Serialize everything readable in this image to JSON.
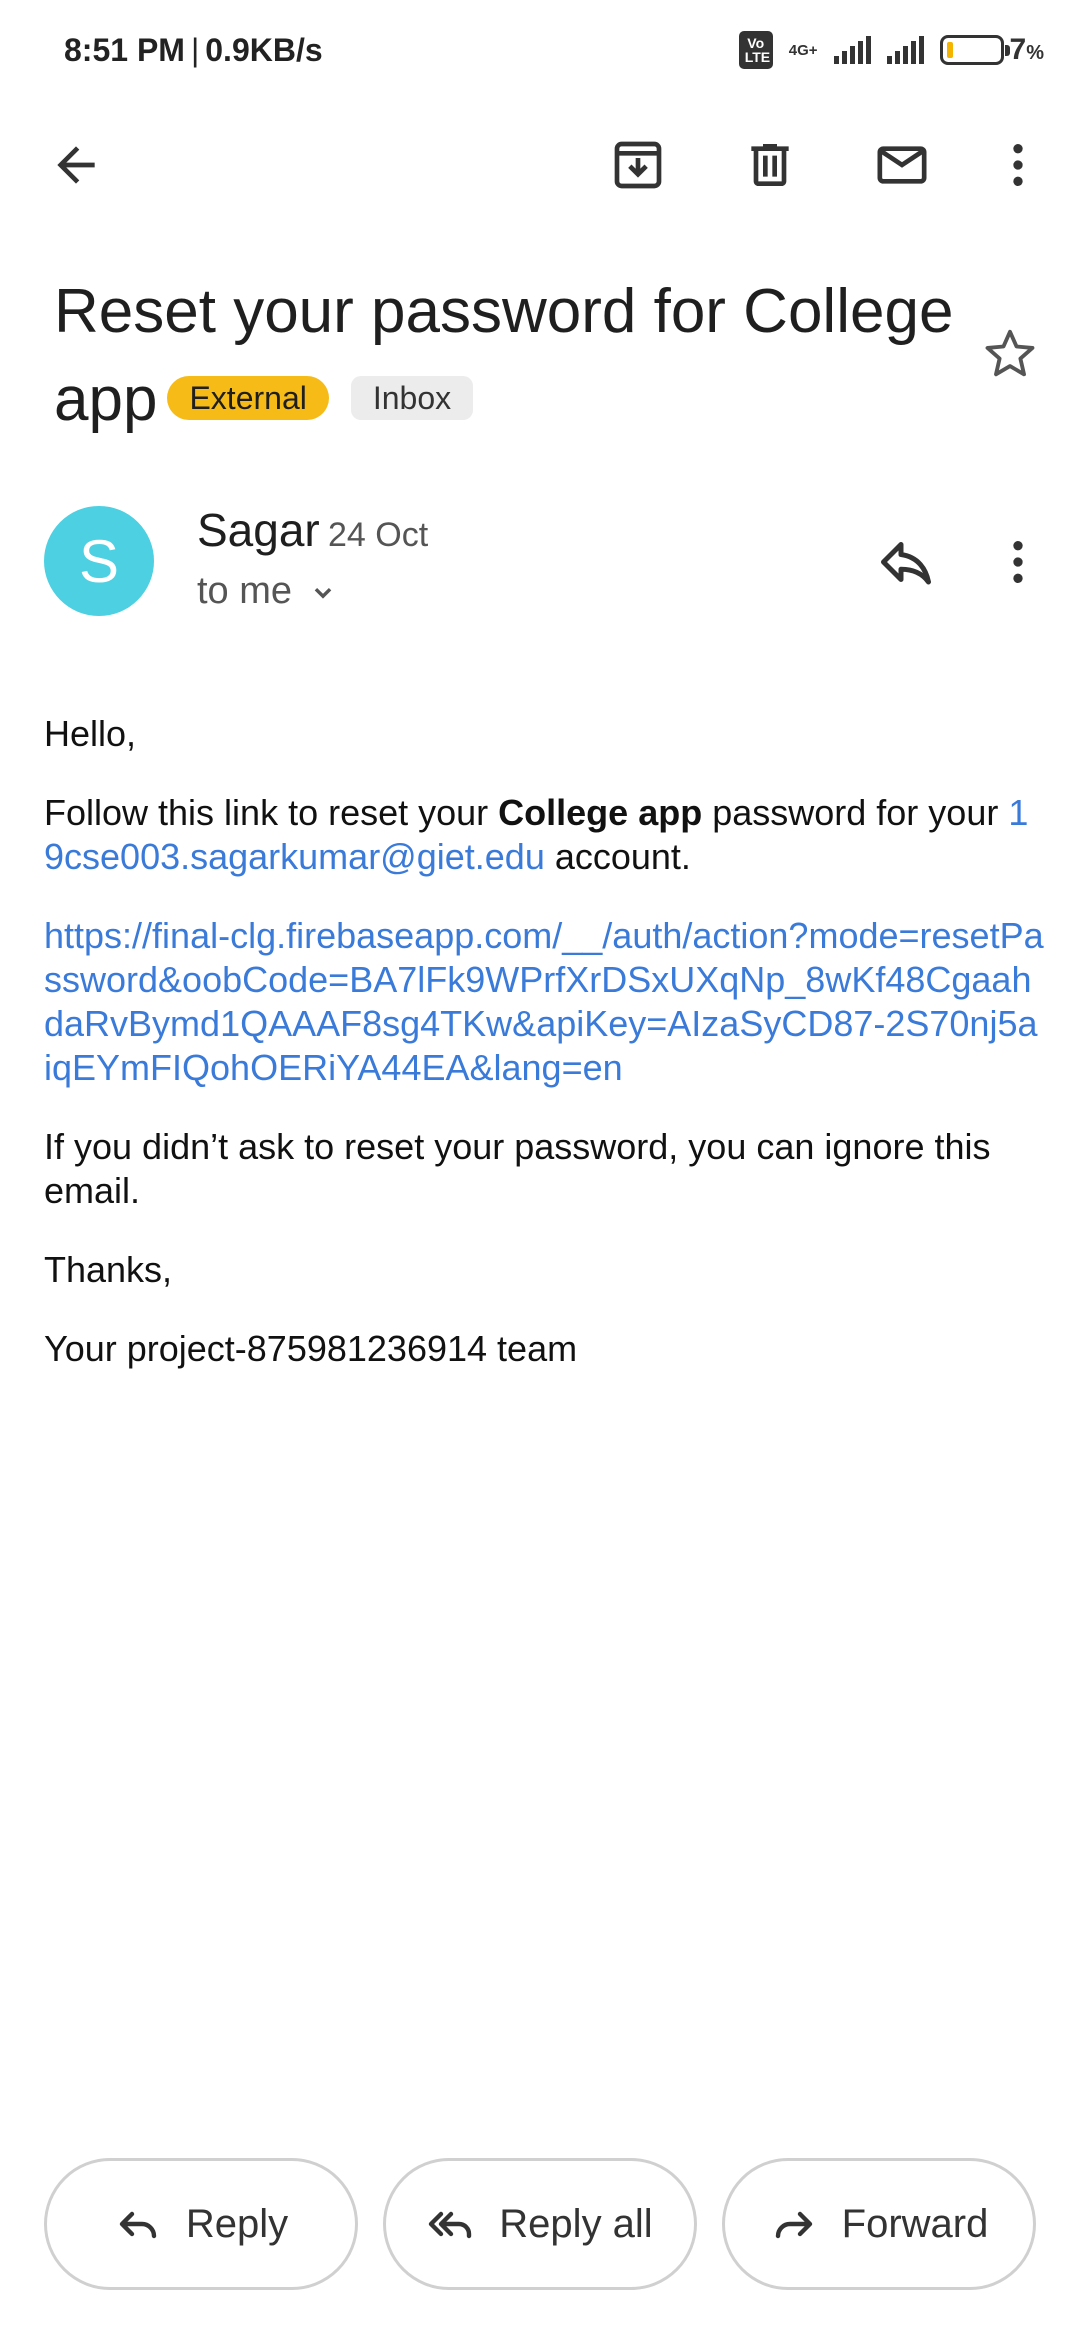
{
  "status_bar": {
    "time": "8:51 PM",
    "separator": "|",
    "net_speed": "0.9KB/s",
    "volte_label": "Vo LTE",
    "network_type": "4G+",
    "battery_percent": "7",
    "battery_unit": "%"
  },
  "toolbar": {
    "icons": [
      "back-arrow-icon",
      "archive-icon",
      "delete-icon",
      "mark-unread-icon",
      "more-vert-icon"
    ]
  },
  "email": {
    "subject": "Reset your password for College app",
    "labels": {
      "external": "External",
      "inbox": "Inbox"
    },
    "sender": {
      "avatar_letter": "S",
      "avatar_color": "#4dd0e1",
      "name": "Sagar",
      "date": "24 Oct",
      "recipient": "to me"
    },
    "body": {
      "greeting": "Hello,",
      "line1_pre": "Follow this link to reset your ",
      "line1_bold": "College app",
      "line1_post": " password for your ",
      "account_email": "19cse003.sagarkumar@giet.edu",
      "line1_end": " account.",
      "reset_link": "https://final-clg.firebaseapp.com/__/auth/action?mode=resetPassword&oobCode=BA7lFk9WPrfXrDSxUXqNp_8wKf48CgaahdaRvBymd1QAAAF8sg4TKw&apiKey=AIzaSyCD87-2S70nj5aiqEYmFIQohOERiYA44EA&lang=en",
      "ignore_note": "If you didn’t ask to reset your password, you can ignore this email.",
      "thanks": "Thanks,",
      "signature": "Your project-875981236914 team"
    }
  },
  "actions": {
    "reply": "Reply",
    "reply_all": "Reply all",
    "forward": "Forward"
  },
  "colors": {
    "link": "#3a7ad9",
    "external_chip": "#f6bb17",
    "inbox_chip": "#ececec"
  }
}
